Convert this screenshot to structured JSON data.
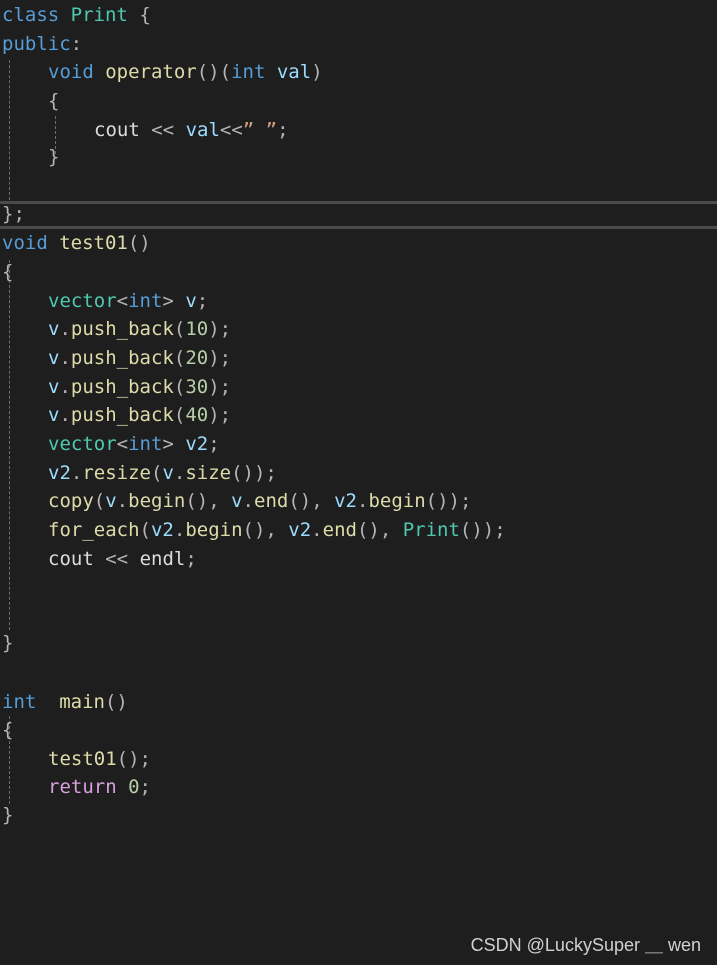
{
  "code": {
    "l1": {
      "kw": "class",
      "type": "Print",
      "brace": "{"
    },
    "l2": {
      "kw": "public",
      "colon": ":"
    },
    "l3": {
      "kw": "void",
      "func": "operator",
      "parens": "()",
      "lparen": "(",
      "kw2": "int",
      "param": "val",
      "rparen": ")"
    },
    "l4": {
      "brace": "{"
    },
    "l5": {
      "ident": "cout",
      "op": "<<",
      "param": "val",
      "op2": "<<",
      "str": "” ”",
      "semi": ";"
    },
    "l6": {
      "brace": "}"
    },
    "l7": {
      "brace": "}",
      "semi": ";"
    },
    "l8": {
      "kw": "void",
      "func": "test01",
      "parens": "()"
    },
    "l9": {
      "brace": "{"
    },
    "l10": {
      "type": "vector",
      "lt": "<",
      "kw": "int",
      "gt": ">",
      "var": "v",
      "semi": ";"
    },
    "l11": {
      "var": "v",
      "dot": ".",
      "func": "push_back",
      "lparen": "(",
      "num": "10",
      "rparen": ")",
      "semi": ";"
    },
    "l12": {
      "var": "v",
      "dot": ".",
      "func": "push_back",
      "lparen": "(",
      "num": "20",
      "rparen": ")",
      "semi": ";"
    },
    "l13": {
      "var": "v",
      "dot": ".",
      "func": "push_back",
      "lparen": "(",
      "num": "30",
      "rparen": ")",
      "semi": ";"
    },
    "l14": {
      "var": "v",
      "dot": ".",
      "func": "push_back",
      "lparen": "(",
      "num": "40",
      "rparen": ")",
      "semi": ";"
    },
    "l15": {
      "type": "vector",
      "lt": "<",
      "kw": "int",
      "gt": ">",
      "var": "v2",
      "semi": ";"
    },
    "l16": {
      "var": "v2",
      "dot": ".",
      "func": "resize",
      "lparen": "(",
      "var2": "v",
      "dot2": ".",
      "func2": "size",
      "tail": "());"
    },
    "l17": {
      "func": "copy",
      "lparen": "(",
      "v1": "v",
      "d1": ".",
      "f1": "begin",
      "s1": "(), ",
      "v2": "v",
      "d2": ".",
      "f2": "end",
      "s2": "(), ",
      "v3": "v2",
      "d3": ".",
      "f3": "begin",
      "tail": "());"
    },
    "l18": {
      "func": "for_each",
      "lparen": "(",
      "v1": "v2",
      "d1": ".",
      "f1": "begin",
      "s1": "(), ",
      "v2": "v2",
      "d2": ".",
      "f2": "end",
      "s2": "(), ",
      "type": "Print",
      "tail": "());"
    },
    "l19": {
      "ident": "cout",
      "op": "<<",
      "ident2": "endl",
      "semi": ";"
    },
    "l20": {
      "brace": "}"
    },
    "l21": {
      "kw": "int",
      "func": "main",
      "parens": "()"
    },
    "l22": {
      "brace": "{"
    },
    "l23": {
      "func": "test01",
      "tail": "();"
    },
    "l24": {
      "kw": "return",
      "num": "0",
      "semi": ";"
    },
    "l25": {
      "brace": "}"
    }
  },
  "watermark": "CSDN @LuckySuper ＿ wen",
  "colors": {
    "background": "#1e1e1e",
    "keyword": "#569cd6",
    "control": "#d8a0df",
    "type": "#4ec9b0",
    "variable": "#9cdcfe",
    "function": "#dcdcaa",
    "number": "#b5cea8",
    "string": "#d69d85"
  }
}
